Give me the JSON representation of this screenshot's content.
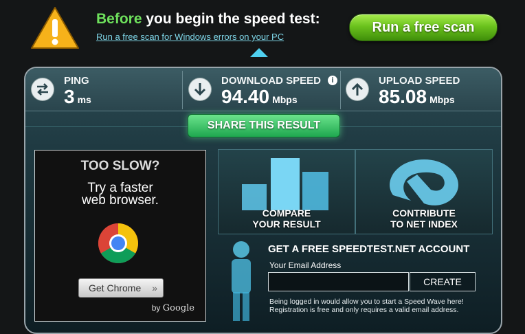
{
  "banner": {
    "headline_green": "Before",
    "headline_rest": " you begin the speed test:",
    "link_text": "Run a free scan for Windows errors on your PC",
    "scan_button": "Run a free scan"
  },
  "stats": {
    "ping": {
      "label": "PING",
      "value": "3",
      "unit": "ms"
    },
    "download": {
      "label": "DOWNLOAD SPEED",
      "value": "94.40",
      "unit": "Mbps",
      "info": "i"
    },
    "upload": {
      "label": "UPLOAD SPEED",
      "value": "85.08",
      "unit": "Mbps"
    }
  },
  "share_button": "SHARE THIS RESULT",
  "ad": {
    "title": "TOO SLOW?",
    "line1": "Try a faster",
    "line2": "web browser.",
    "button": "Get Chrome",
    "button_arrow": "»",
    "by": "by",
    "brand": "Google"
  },
  "tiles": {
    "compare": {
      "line1": "COMPARE",
      "line2": "YOUR RESULT"
    },
    "contribute": {
      "line1": "CONTRIBUTE",
      "line2": "TO NET INDEX"
    }
  },
  "account": {
    "title": "GET A FREE SPEEDTEST.NET ACCOUNT",
    "email_label": "Your Email Address",
    "email_value": "",
    "create_button": "CREATE",
    "fine_line1": "Being logged in would allow you to start a Speed Wave here!",
    "fine_line2": "Registration is free and only requires a valid email address."
  },
  "colors": {
    "accent_green": "#6ee05c",
    "link_cyan": "#7fd6e8",
    "panel_teal": "#2a454d",
    "pointer_cyan": "#4fd0f0"
  },
  "icons": [
    "warning-icon",
    "ping-arrows-icon",
    "download-arrow-icon",
    "info-icon",
    "upload-arrow-icon",
    "chrome-logo-icon"
  ]
}
